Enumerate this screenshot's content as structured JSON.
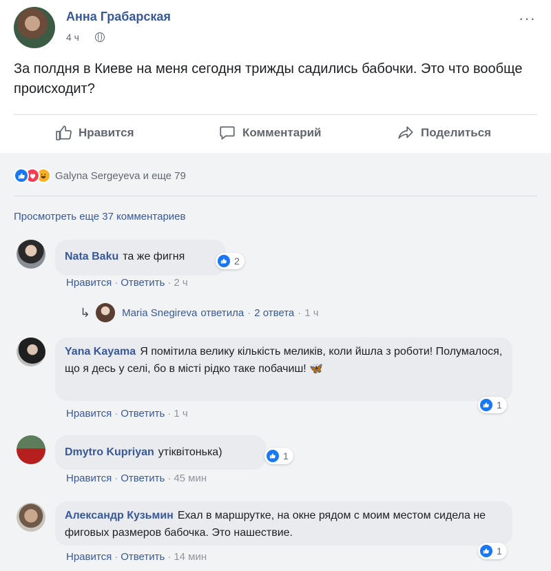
{
  "post": {
    "author": "Анна Грабарская",
    "time": "4 ч",
    "privacy_icon": "globe-icon",
    "text": "За полдня в Киеве на меня сегодня трижды садились бабочки. Это что вообще происходит?",
    "more_icon": "ellipsis-icon",
    "more_glyph": "···"
  },
  "actions": {
    "like": "Нравится",
    "comment": "Комментарий",
    "share": "Поделиться"
  },
  "reactions": {
    "text": "Galyna Sergeyeva и еще 79",
    "icons": [
      "like-icon",
      "love-icon",
      "haha-icon"
    ]
  },
  "view_more": "Просмотреть еще 37 комментариев",
  "comments": [
    {
      "name": "Nata Baku",
      "text": "та же фигня",
      "likes": "2",
      "like_label": "Нравится",
      "reply_label": "Ответить",
      "time": "2 ч"
    },
    {
      "name": "Yana Kayama",
      "text": "Я помітила велику кількість меликів, коли йшла з роботи! Полумалося, що я десь у селі, бо в місті рідко таке побачиш! 🦋",
      "likes": "1",
      "like_label": "Нравится",
      "reply_label": "Ответить",
      "time": "1 ч"
    },
    {
      "name": "Dmytro Kupriyan",
      "text": "утіквітонька)",
      "likes": "1",
      "like_label": "Нравится",
      "reply_label": "Ответить",
      "time": "45 мин"
    },
    {
      "name": "Александр Кузьмин",
      "text": "Ехал в маршрутке, на окне рядом с моим местом сидела не фиговых размеров бабочка. Это нашествие.",
      "likes": "1",
      "like_label": "Нравится",
      "reply_label": "Ответить",
      "time": "14 мин"
    }
  ],
  "reply": {
    "name": "Maria Snegireva",
    "action": "ответила",
    "count": "2 ответа",
    "time": "1 ч"
  },
  "colors": {
    "link": "#385898",
    "like_blue": "#1877f2",
    "love_red": "#f33e58",
    "haha_yellow": "#f7b125",
    "bubble": "#e9ebee"
  }
}
